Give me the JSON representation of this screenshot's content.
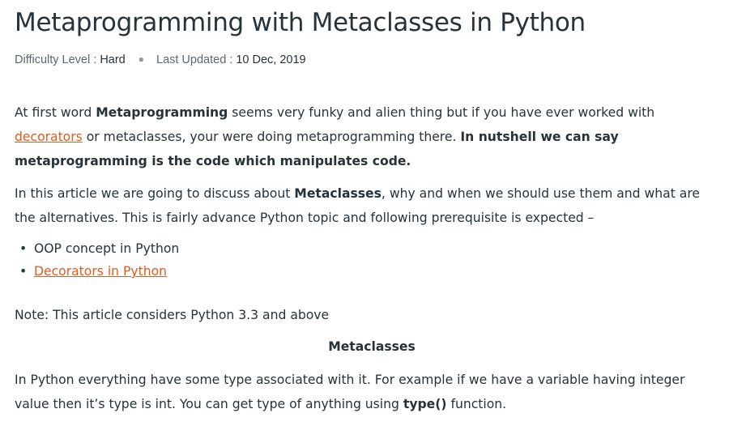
{
  "article": {
    "title": "Metaprogramming with Metaclasses in Python",
    "meta": {
      "difficulty_label": "Difficulty Level : ",
      "difficulty_value": "Hard",
      "separator": "●",
      "updated_label": "Last Updated : ",
      "updated_value": "10 Dec, 2019"
    },
    "para1": {
      "t1": "At first word ",
      "b1": "Metaprogramming",
      "t2": " seems very funky and alien thing but if you have ever worked with",
      "link": "decorators",
      "t3": " or metaclasses, your were doing metaprogramming there. ",
      "b2": "In nutshell we can say",
      "b3": "metaprogramming is the code which manipulates code."
    },
    "para2": {
      "t1": "In this article we are going to discuss about ",
      "b1": "Metaclasses",
      "t2": ", why and when we should use them and what are",
      "t3": "the alternatives. This is fairly advance Python topic and following prerequisite is expected –"
    },
    "prerequisites": [
      {
        "bullet": "•",
        "text": "OOP concept in Python",
        "is_link": false
      },
      {
        "bullet": "•",
        "text": "Decorators in Python",
        "is_link": true
      }
    ],
    "note": "Note: This article considers Python 3.3 and above",
    "section_heading": "Metaclasses",
    "para3": {
      "t1": "In Python everything have some type associated with it. For example if we have a variable having integer",
      "t2": "value then it’s type is int. You can get type of anything using ",
      "code": "type()",
      "t3": " function."
    },
    "colors": {
      "text": "#273239",
      "link": "#e35a1c",
      "muted": "#5b6870"
    }
  }
}
